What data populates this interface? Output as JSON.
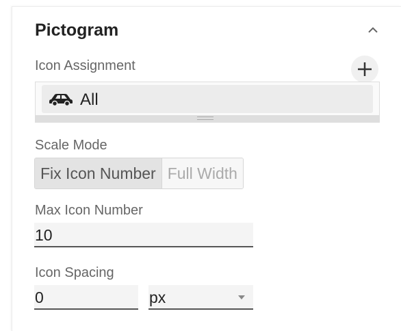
{
  "panel": {
    "title": "Pictogram"
  },
  "icon_assignment": {
    "label": "Icon Assignment",
    "items": [
      {
        "icon": "car-icon",
        "label": "All"
      }
    ]
  },
  "scale_mode": {
    "label": "Scale Mode",
    "options": [
      "Fix Icon Number",
      "Full Width"
    ],
    "selected": "Fix Icon Number"
  },
  "max_icon_number": {
    "label": "Max Icon Number",
    "value": "10"
  },
  "icon_spacing": {
    "label": "Icon Spacing",
    "value": "0",
    "unit": "px"
  }
}
